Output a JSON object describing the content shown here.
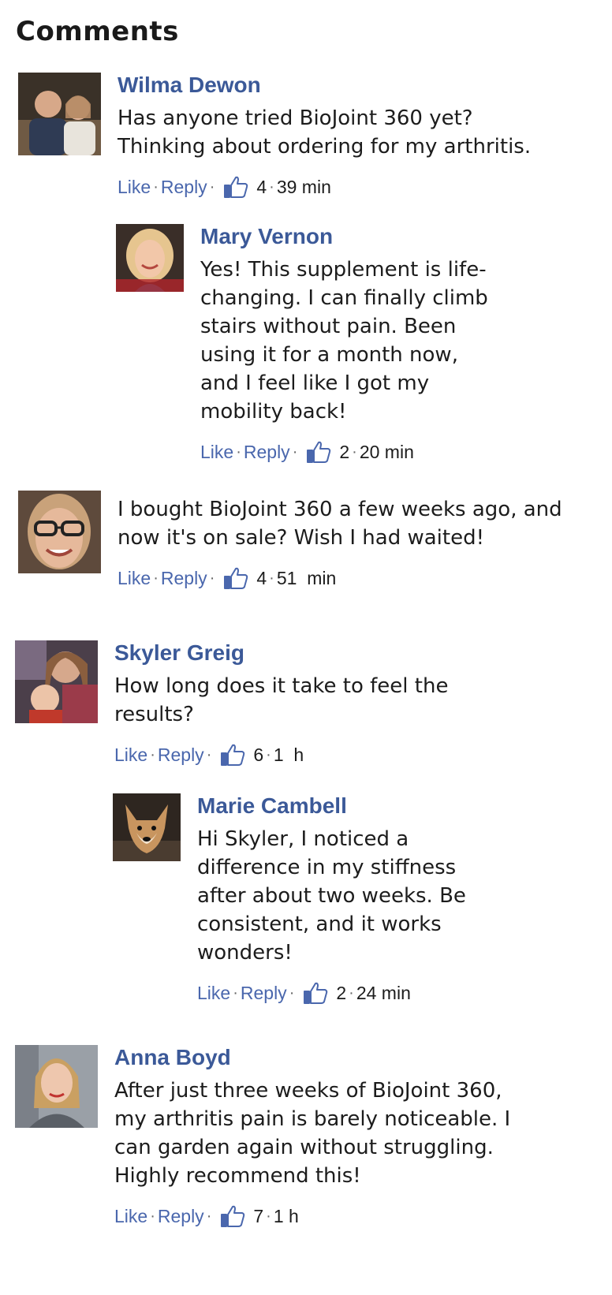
{
  "heading": "Comments",
  "separator": "·",
  "like_label": "Like",
  "reply_label": "Reply",
  "comments": [
    {
      "author": "Wilma Dewon",
      "text": "Has anyone tried BioJoint 360 yet? Thinking about ordering for my arthritis.",
      "likes": "4",
      "time": "39 min",
      "avatar_colors": [
        "#4a4036",
        "#d9b39c"
      ]
    },
    {
      "author": "Mary Vernon",
      "text": "Yes! This supplement is life-changing. I can finally climb stairs without pain. Been using it for a month now, and I feel like I got my mobility back!",
      "likes": "2",
      "time": "20 min",
      "avatar_colors": [
        "#c9a67a",
        "#f0c9a8"
      ]
    },
    {
      "author": "",
      "text": "I bought BioJoint 360 a few weeks ago, and now it's on sale? Wish I had waited!",
      "likes": "4",
      "time": "51  min",
      "avatar_colors": [
        "#6b5443",
        "#e3b79a"
      ]
    },
    {
      "author": "Skyler Greig",
      "text": "How long does it take to feel the results?",
      "likes": "6",
      "time": "1  h",
      "avatar_colors": [
        "#5a4b56",
        "#d6a88c"
      ]
    },
    {
      "author": "Marie Cambell",
      "text": "Hi Skyler, I noticed a difference in my stiffness after about two weeks. Be consistent, and it works wonders!",
      "likes": "2",
      "time": "24 min",
      "avatar_colors": [
        "#3d3027",
        "#c8955f"
      ]
    },
    {
      "author": "Anna Boyd",
      "text": "After just three weeks of BioJoint 360, my arthritis pain is barely noticeable. I can garden again without struggling. Highly recommend this!",
      "likes": "7",
      "time": "1 h",
      "avatar_colors": [
        "#8a8f96",
        "#e8c4ac"
      ]
    }
  ]
}
